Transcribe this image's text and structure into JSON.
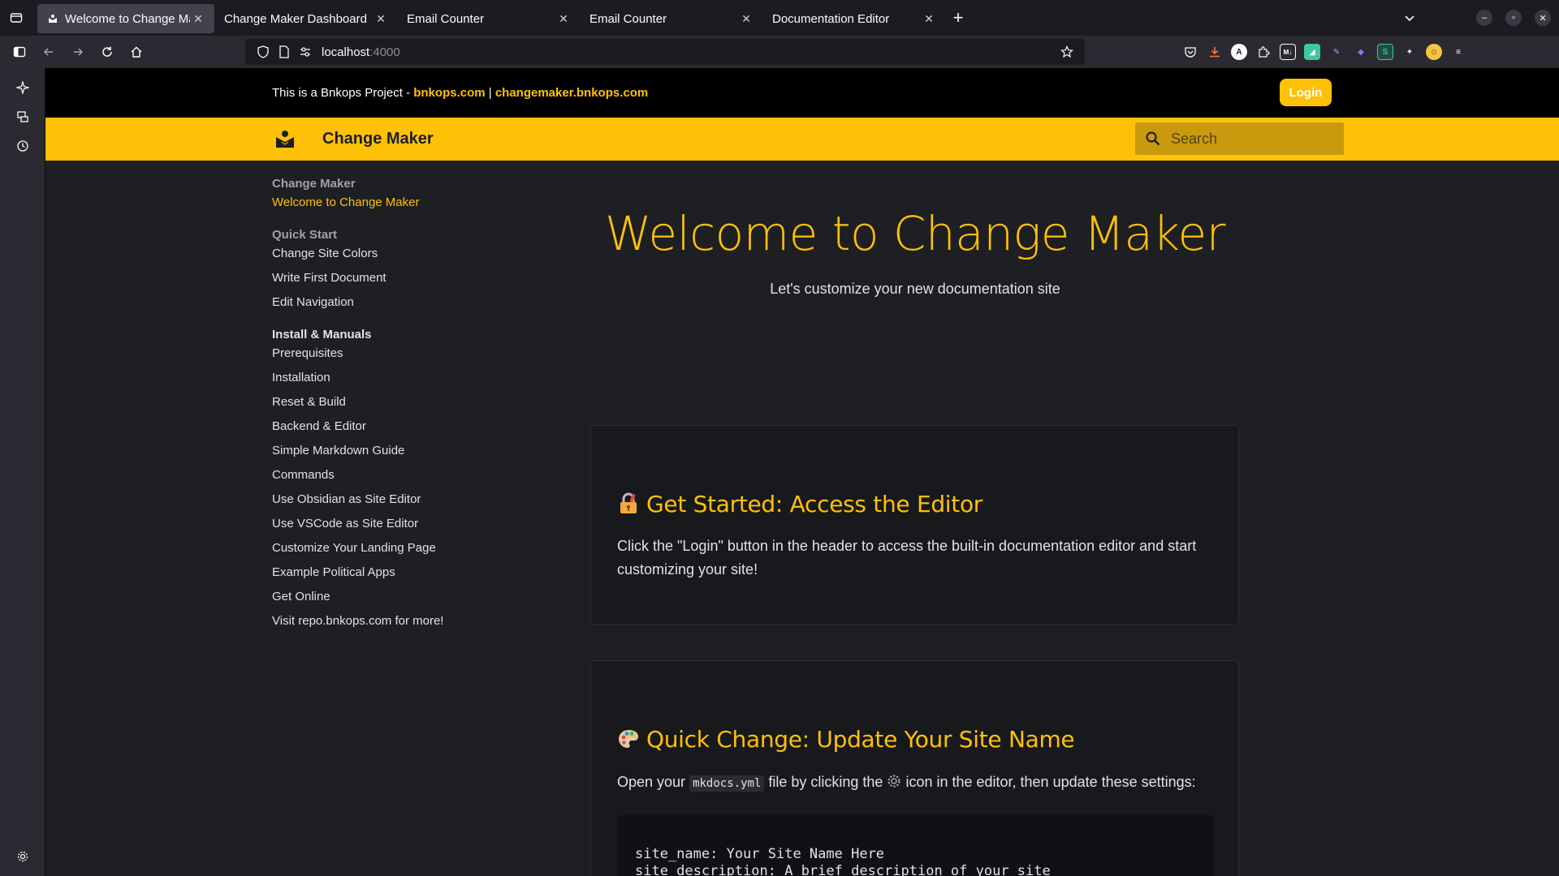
{
  "browser": {
    "tabs": [
      {
        "label": "Welcome to Change Maker",
        "active": true
      },
      {
        "label": "Change Maker Dashboard",
        "active": false
      },
      {
        "label": "Email Counter",
        "active": false
      },
      {
        "label": "Email Counter",
        "active": false
      },
      {
        "label": "Documentation Editor",
        "active": false
      }
    ],
    "url_host": "localhost",
    "url_port": ":4000"
  },
  "topbar": {
    "project_text": "This is a Bnkops Project - ",
    "link1": "bnkops.com",
    "separator": " | ",
    "link2": "changemaker.bnkops.com",
    "login_label": "Login"
  },
  "header": {
    "site_title": "Change Maker",
    "search_placeholder": "Search"
  },
  "nav": {
    "sections": [
      {
        "title": "Change Maker",
        "items": [
          "Welcome to Change Maker"
        ]
      },
      {
        "title": "Quick Start",
        "items": [
          "Change Site Colors",
          "Write First Document",
          "Edit Navigation"
        ]
      },
      {
        "title": "Install & Manuals",
        "items": [
          "Prerequisites",
          "Installation",
          "Reset & Build",
          "Backend & Editor",
          "Simple Markdown Guide",
          "Commands",
          "Use Obsidian as Site Editor",
          "Use VSCode as Site Editor",
          "Customize Your Landing Page",
          "Example Political Apps",
          "Get Online",
          "Visit repo.bnkops.com for more!"
        ]
      }
    ]
  },
  "hero": {
    "title": "Welcome to Change Maker",
    "subtitle": "Let's customize your new documentation site"
  },
  "cards": [
    {
      "title": "Get Started: Access the Editor",
      "body": "Click the \"Login\" button in the header to access the built-in documentation editor and start customizing your site!"
    },
    {
      "title": "Quick Change: Update Your Site Name",
      "body_before": "Open your ",
      "code": "mkdocs.yml",
      "body_middle": " file by clicking the ",
      "body_after": " icon in the editor, then update these settings:",
      "code_lines": "site_name: Your Site Name Here\nsite_description: A brief description of your site"
    }
  ],
  "colors": {
    "accent": "#ffc107",
    "page_bg": "#1e1f22",
    "card_bg": "#18191c"
  }
}
